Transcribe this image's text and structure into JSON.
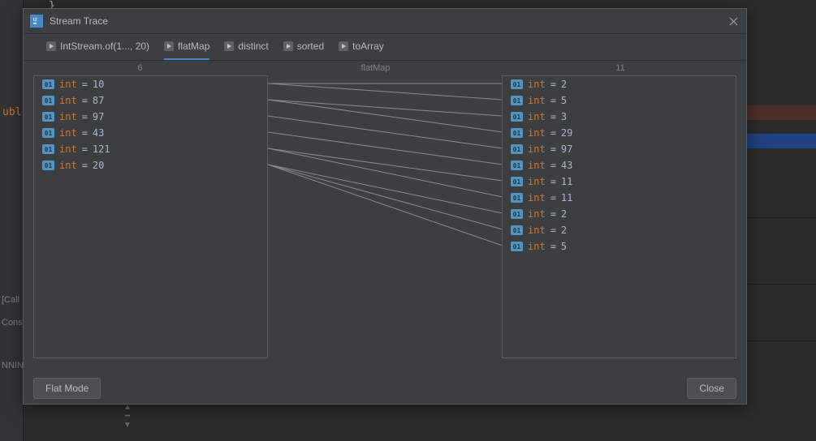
{
  "dialog": {
    "title": "Stream Trace",
    "close_icon": "×",
    "tabs": [
      {
        "label": "IntStream.of(1..., 20)"
      },
      {
        "label": "flatMap",
        "active": true
      },
      {
        "label": "distinct"
      },
      {
        "label": "sorted"
      },
      {
        "label": "toArray"
      }
    ],
    "left_count": "6",
    "center_label": "flatMap",
    "right_count": "11",
    "left_items": [
      {
        "type": "int",
        "value": "10"
      },
      {
        "type": "int",
        "value": "87"
      },
      {
        "type": "int",
        "value": "97"
      },
      {
        "type": "int",
        "value": "43"
      },
      {
        "type": "int",
        "value": "121"
      },
      {
        "type": "int",
        "value": "20"
      }
    ],
    "right_items": [
      {
        "type": "int",
        "value": "2"
      },
      {
        "type": "int",
        "value": "5"
      },
      {
        "type": "int",
        "value": "3"
      },
      {
        "type": "int",
        "value": "29"
      },
      {
        "type": "int",
        "value": "97"
      },
      {
        "type": "int",
        "value": "43"
      },
      {
        "type": "int",
        "value": "11"
      },
      {
        "type": "int",
        "value": "11"
      },
      {
        "type": "int",
        "value": "2"
      },
      {
        "type": "int",
        "value": "2"
      },
      {
        "type": "int",
        "value": "5"
      }
    ],
    "connections": [
      [
        0,
        0
      ],
      [
        0,
        1
      ],
      [
        1,
        2
      ],
      [
        1,
        3
      ],
      [
        2,
        4
      ],
      [
        3,
        5
      ],
      [
        4,
        6
      ],
      [
        4,
        7
      ],
      [
        5,
        8
      ],
      [
        5,
        9
      ],
      [
        5,
        10
      ]
    ],
    "badge_text": "01",
    "flat_mode_label": "Flat Mode",
    "close_label": "Close"
  },
  "background": {
    "brace": "}",
    "kw": "ubl",
    "callers": "[Call",
    "console": "Cons",
    "running": "NNIN"
  }
}
